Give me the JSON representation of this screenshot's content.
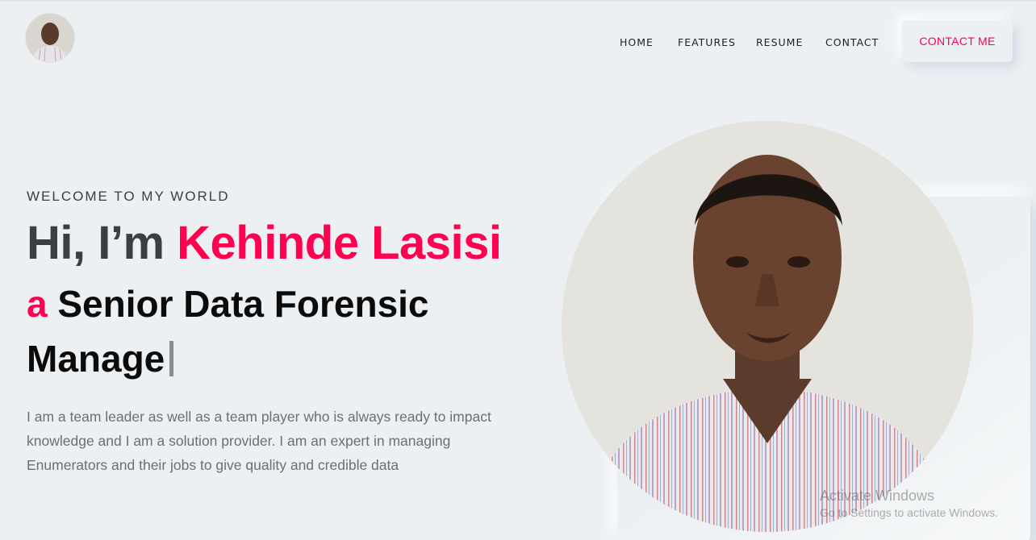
{
  "header": {
    "logo_alt": "profile avatar",
    "nav": [
      "HOME",
      "FEATURES",
      "RESUME",
      "CONTACT"
    ],
    "cta_label": "CONTACT ME"
  },
  "hero": {
    "welcome": "WELCOME TO MY WORLD",
    "greeting_prefix": "Hi, I’m ",
    "name": "Kehinde Lasisi",
    "role_article": "a",
    "role_text": " Senior Data Forensic Manage",
    "description": "I am a team leader as well as a team player who is always ready to impact knowledge and I am a solution provider. I am an expert in managing Enumerators and their jobs to give quality and credible data"
  },
  "watermark": {
    "line1": "Activate Windows",
    "line2": "Go to Settings to activate Windows."
  },
  "colors": {
    "accent": "#ff014f",
    "background": "#ecf0f3",
    "heading": "#3c3e41"
  }
}
